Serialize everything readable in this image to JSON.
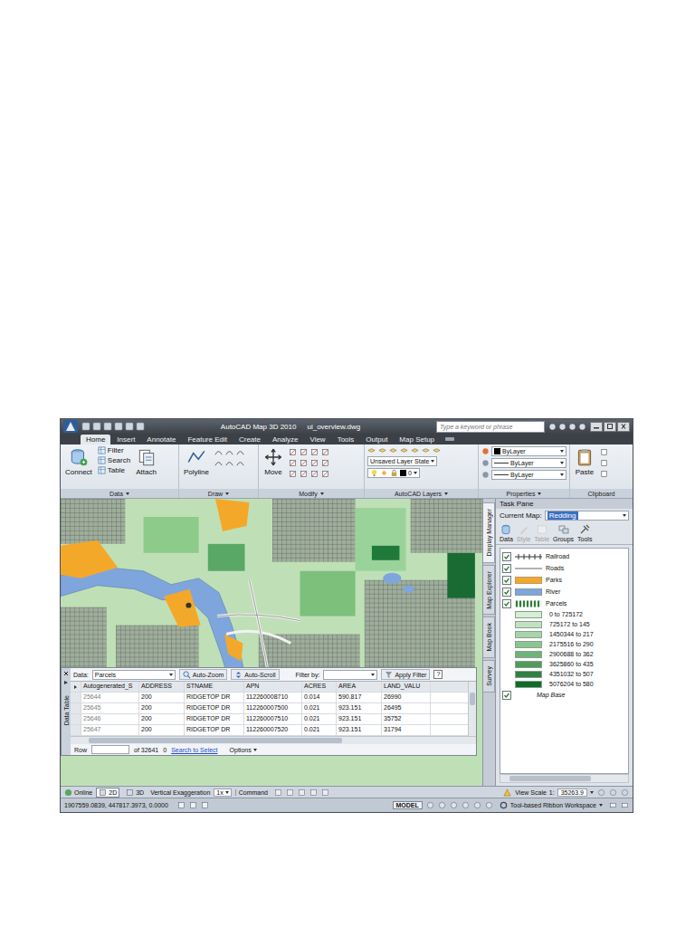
{
  "window": {
    "app_title": "AutoCAD Map 3D 2010",
    "file_name": "ui_overview.dwg",
    "search_placeholder": "Type a keyword or phrase"
  },
  "ribbon_tabs": [
    {
      "label": "Home",
      "selected": true
    },
    {
      "label": "Insert",
      "selected": false
    },
    {
      "label": "Annotate",
      "selected": false
    },
    {
      "label": "Feature Edit",
      "selected": false
    },
    {
      "label": "Create",
      "selected": false
    },
    {
      "label": "Analyze",
      "selected": false
    },
    {
      "label": "View",
      "selected": false
    },
    {
      "label": "Tools",
      "selected": false
    },
    {
      "label": "Output",
      "selected": false
    },
    {
      "label": "Map Setup",
      "selected": false
    }
  ],
  "ribbon": {
    "data_panel": {
      "label": "Data",
      "connect": "Connect",
      "small": [
        "Filter",
        "Search",
        "Table"
      ],
      "attach": "Attach"
    },
    "draw_panel": {
      "label": "Draw",
      "polyline": "Polyline"
    },
    "modify_panel": {
      "label": "Modify",
      "move": "Move"
    },
    "layers_panel": {
      "label": "AutoCAD Layers",
      "layer_state": "Unsaved Layer State",
      "current_layer": "0"
    },
    "properties_panel": {
      "label": "Properties",
      "values": [
        "ByLayer",
        "ByLayer",
        "ByLayer"
      ]
    },
    "clipboard_panel": {
      "label": "Clipboard",
      "paste": "Paste"
    }
  },
  "task_pane": {
    "title": "Task Pane",
    "current_map_label": "Current Map:",
    "current_map": "Redding",
    "side_tabs": [
      {
        "label": "Display Manager",
        "selected": true
      },
      {
        "label": "Map Explorer",
        "selected": false
      },
      {
        "label": "Map Book",
        "selected": false
      },
      {
        "label": "Survey",
        "selected": false
      }
    ],
    "tools": [
      {
        "label": "Data",
        "disabled": false
      },
      {
        "label": "Style",
        "disabled": true
      },
      {
        "label": "Table",
        "disabled": true
      },
      {
        "label": "Groups",
        "disabled": false
      },
      {
        "label": "Tools",
        "disabled": false
      }
    ],
    "layers": [
      {
        "name": "Railroad",
        "checked": true,
        "kind": "railroad",
        "color": "#333333"
      },
      {
        "name": "Roads",
        "checked": true,
        "kind": "line",
        "color": "#666666"
      },
      {
        "name": "Parks",
        "checked": true,
        "kind": "fill",
        "color": "#f4a82a"
      },
      {
        "name": "River",
        "checked": true,
        "kind": "fill",
        "color": "#7ea6dc"
      },
      {
        "name": "Parcels",
        "checked": true,
        "kind": "theme",
        "color": "#2f7d3c"
      }
    ],
    "parcel_legend": [
      {
        "label": "0 to 725172",
        "color": "#d6eed6"
      },
      {
        "label": "725172 to 145",
        "color": "#bfe2c0"
      },
      {
        "label": "1450344 to 217",
        "color": "#a6d4a9"
      },
      {
        "label": "2175516 to 290",
        "color": "#8cc591"
      },
      {
        "label": "2900688 to 362",
        "color": "#6fb27a"
      },
      {
        "label": "3625860 to 435",
        "color": "#4f9b5e"
      },
      {
        "label": "4351032 to 507",
        "color": "#2f8144"
      },
      {
        "label": "5076204 to 580",
        "color": "#0f6a2c"
      }
    ],
    "map_base": {
      "name": "Map Base",
      "checked": true
    }
  },
  "data_table": {
    "side_label": "Data Table",
    "data_label": "Data:",
    "source": "Parcels",
    "auto_zoom": "Auto-Zoom",
    "auto_scroll": "Auto-Scroll",
    "filter_label": "Filter by:",
    "apply_filter": "Apply Filter",
    "help": "?",
    "columns": [
      "Autogenerated_S",
      "ADDRESS",
      "STNAME",
      "APN",
      "ACRES",
      "AREA",
      "LAND_VALU"
    ],
    "rows": [
      [
        "25644",
        "200",
        "RIDGETOP DR",
        "112260008710",
        "0.014",
        "590.817",
        "26990"
      ],
      [
        "25645",
        "200",
        "RIDGETOP DR",
        "112260007500",
        "0.021",
        "923.151",
        "26495"
      ],
      [
        "25646",
        "200",
        "RIDGETOP DR",
        "112260007510",
        "0.021",
        "923.151",
        "35752"
      ],
      [
        "25647",
        "200",
        "RIDGETOP DR",
        "112260007520",
        "0.021",
        "923.151",
        "31794"
      ]
    ],
    "row_label": "Row",
    "row_count": "of 32641",
    "selected_count": "0",
    "search_link": "Search to Select",
    "options": "Options"
  },
  "status_bar": {
    "online": "Online",
    "view_modes": [
      {
        "label": "2D",
        "selected": true
      },
      {
        "label": "3D",
        "selected": false
      }
    ],
    "exaggeration_label": "Vertical Exaggeration",
    "exaggeration": "1x",
    "command": "Command",
    "view_scale_label": "View Scale",
    "scale_prefix": "1:",
    "scale": "35263.9",
    "coordinates": "1907559.0839, 447817.3973, 0.0000",
    "space": "MODEL",
    "workspace": "Tool-based Ribbon Workspace"
  }
}
